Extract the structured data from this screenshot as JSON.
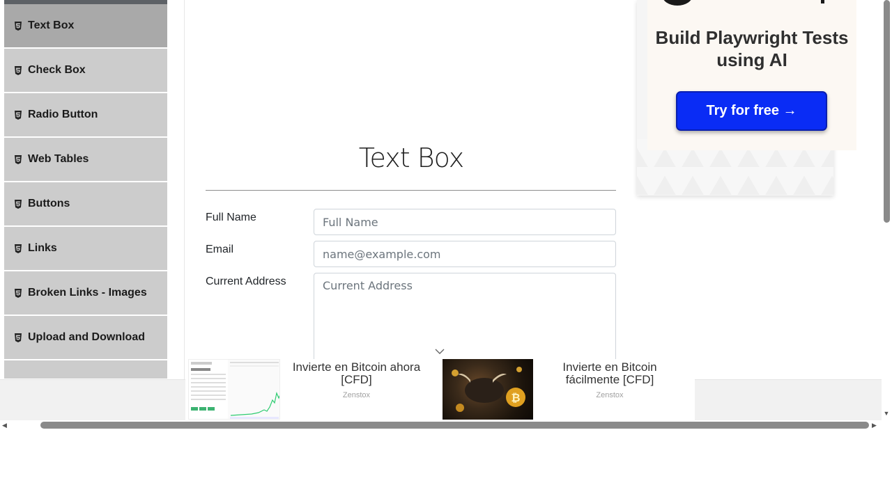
{
  "sidebar": {
    "items": [
      {
        "label": "Text Box",
        "icon": "html5-icon",
        "active": true
      },
      {
        "label": "Check Box",
        "icon": "html5-icon"
      },
      {
        "label": "Radio Button",
        "icon": "html5-icon"
      },
      {
        "label": "Web Tables",
        "icon": "html5-icon"
      },
      {
        "label": "Buttons",
        "icon": "html5-icon"
      },
      {
        "label": "Links",
        "icon": "html5-icon"
      },
      {
        "label": "Broken Links - Images",
        "icon": "html5-icon"
      },
      {
        "label": "Upload and Download",
        "icon": "html5-icon"
      }
    ]
  },
  "main": {
    "title": "Text Box",
    "form": {
      "full_name": {
        "label": "Full Name",
        "placeholder": "Full Name",
        "value": ""
      },
      "email": {
        "label": "Email",
        "placeholder": "name@example.com",
        "value": ""
      },
      "current_address": {
        "label": "Current Address",
        "placeholder": "Current Address",
        "value": ""
      }
    }
  },
  "ad_right": {
    "headline": "Build Playwright Tests using AI",
    "cta": "Try for free →",
    "cta_color": "#0a2cf5"
  },
  "bottom_ad": {
    "items": [
      {
        "title": "Invierte en Bitcoin ahora [CFD]",
        "source": "Zenstox"
      },
      {
        "title": "Invierte en Bitcoin fácilmente [CFD]",
        "source": "Zenstox"
      }
    ]
  },
  "colors": {
    "sidebar_item_bg": "#cccccc",
    "sidebar_item_active_bg": "#a9a9a9"
  }
}
